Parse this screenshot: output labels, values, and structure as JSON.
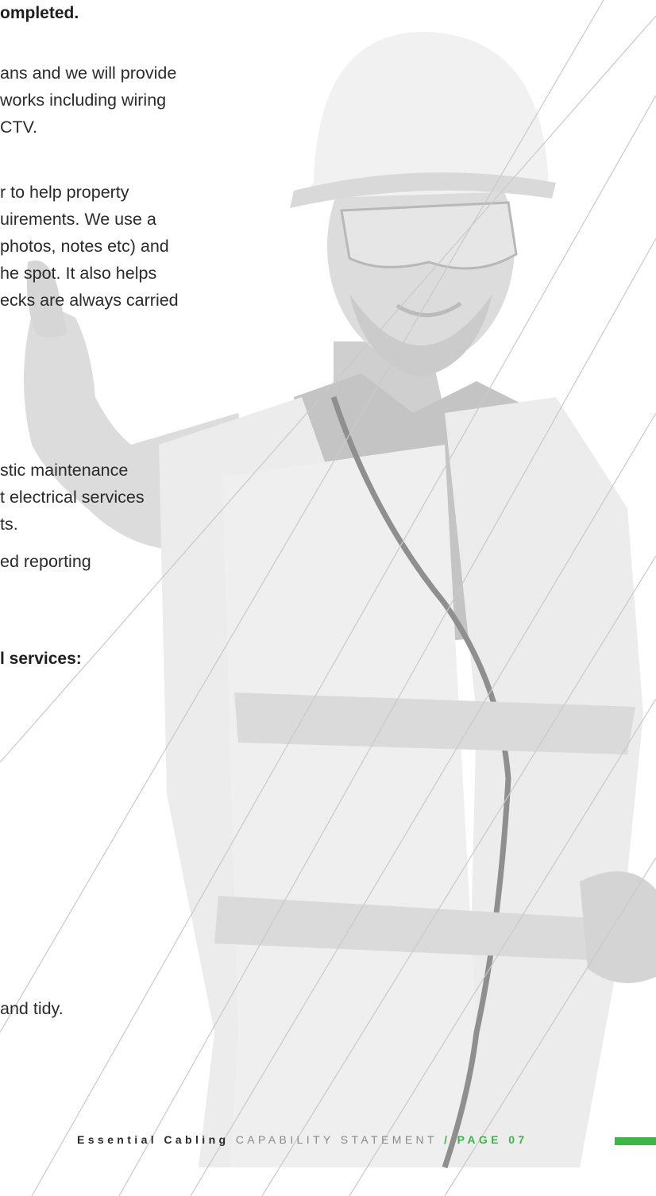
{
  "content": {
    "heading_top": "ompleted.",
    "para_1": [
      "ans and we will provide",
      "works including wiring",
      "CTV."
    ],
    "para_2": [
      "r to help property",
      "uirements. We use a",
      "photos, notes etc) and",
      "he spot. It also helps",
      "ecks are always carried"
    ],
    "para_3": [
      "stic maintenance",
      "t electrical services",
      "ts."
    ],
    "para_4": [
      "ed reporting"
    ],
    "heading_services": "l services:",
    "para_5": [
      "and tidy."
    ]
  },
  "footer": {
    "brand": "Essential Cabling",
    "subtitle": "CAPABILITY STATEMENT",
    "separator": "/",
    "page_label": "PAGE",
    "page_number": "07"
  },
  "colors": {
    "accent": "#3db54a",
    "text": "#2a2a2a",
    "muted": "#8a8a8a"
  },
  "image": {
    "subject": "faded photo of a smiling worker wearing a hard hat, safety glasses, checked shirt and hi-vis vest, giving a thumbs up"
  }
}
